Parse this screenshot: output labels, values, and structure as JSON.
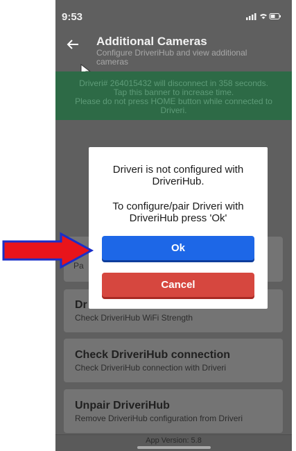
{
  "status_bar": {
    "time": "9:53",
    "icons": "signal wifi battery"
  },
  "header": {
    "title": "Additional Cameras",
    "subtitle": "Configure DriveriHub and view additional cameras"
  },
  "banner": {
    "line1": "Driveri# 264015432 will disconnect in 358 seconds.",
    "line2": "Tap this banner to increase time.",
    "line3": "Please do not press HOME button while connected to",
    "line4": "Driveri."
  },
  "cards": [
    {
      "title": "",
      "subtitle": "Pa"
    },
    {
      "title": "Dr",
      "subtitle": "Check DriveriHub WiFi Strength"
    },
    {
      "title": "Check DriveriHub connection",
      "subtitle": "Check DriveriHub connection with Driveri"
    },
    {
      "title": "Unpair DriveriHub",
      "subtitle": "Remove DriveriHub configuration from Driveri"
    }
  ],
  "dialog": {
    "message1": "Driveri is not configured with DriveriHub.",
    "message2": "To configure/pair Driveri with DriveriHub press 'Ok'",
    "ok_label": "Ok",
    "cancel_label": "Cancel"
  },
  "footer": {
    "app_version": "App Version: 5.8"
  },
  "colors": {
    "banner": "#2d6a46",
    "ok_button": "#1d67e7",
    "cancel_button": "#d6473f",
    "arrow": "#e8141b",
    "arrow_outline": "#1a2fc8"
  },
  "icons": [
    "back-arrow-icon",
    "cursor-icon",
    "red-arrow-annotation"
  ]
}
